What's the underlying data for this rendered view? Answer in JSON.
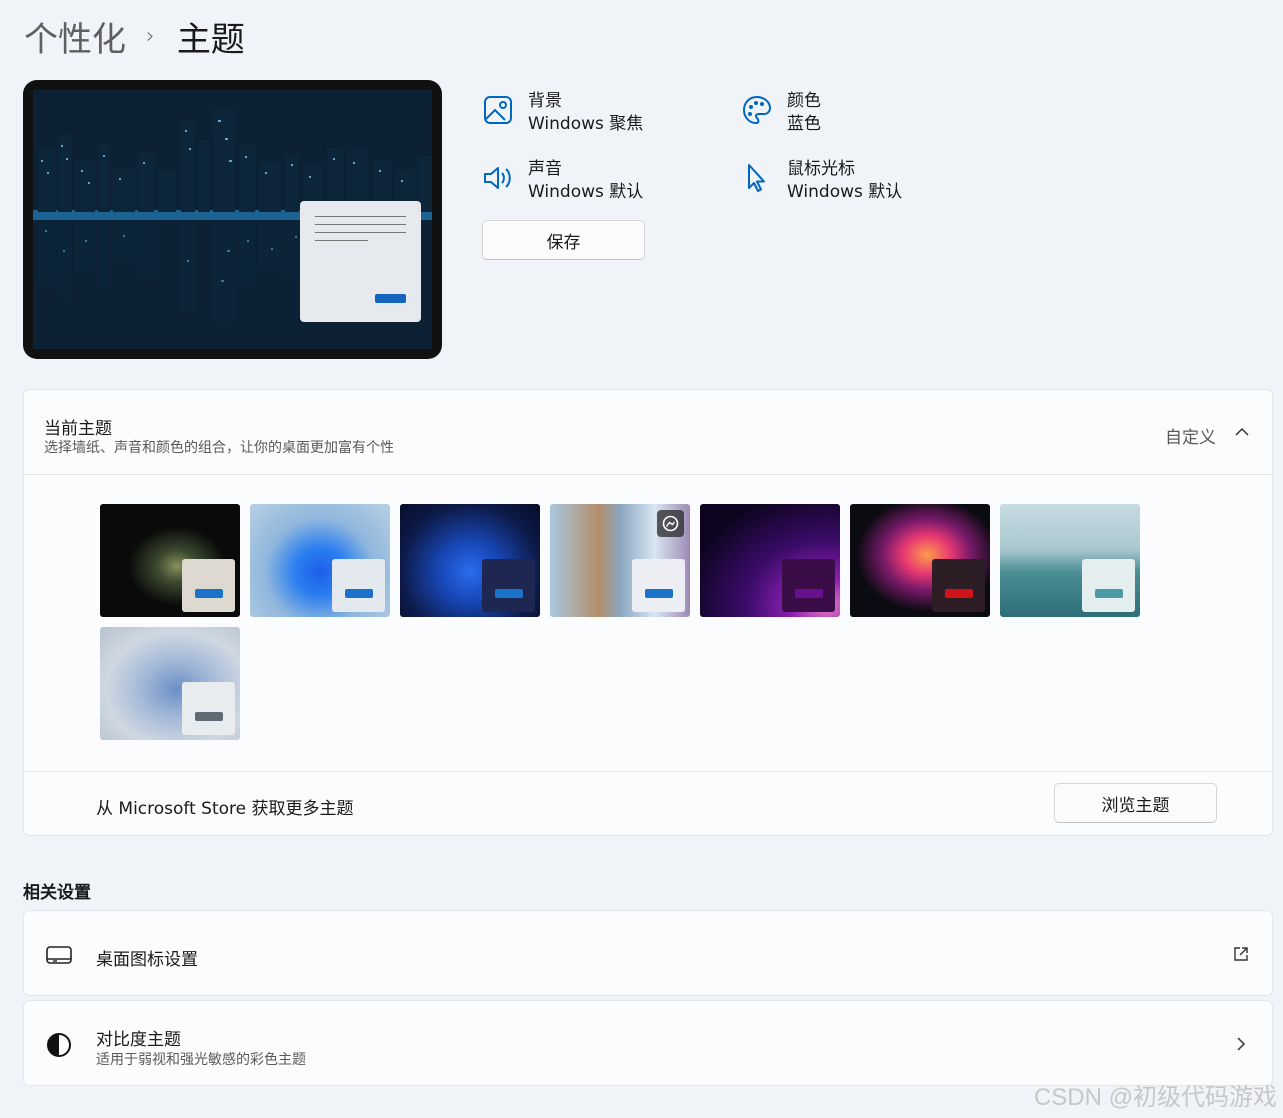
{
  "breadcrumb": {
    "parent": "个性化",
    "separator": "›",
    "current": "主题"
  },
  "theme_attributes": {
    "background": {
      "label": "背景",
      "value": "Windows 聚焦"
    },
    "color": {
      "label": "颜色",
      "value": "蓝色"
    },
    "sound": {
      "label": "声音",
      "value": "Windows 默认"
    },
    "cursor": {
      "label": "鼠标光标",
      "value": "Windows 默认"
    }
  },
  "save_label": "保存",
  "current_theme": {
    "title": "当前主题",
    "subtitle": "选择墙纸、声音和颜色的组合，让你的桌面更加富有个性",
    "value": "自定义",
    "themes": [
      {
        "name": "glow-dark",
        "accent": "#1a73c9"
      },
      {
        "name": "bloom-light",
        "accent": "#1a73c9"
      },
      {
        "name": "bloom-dark",
        "accent": "#1a73c9"
      },
      {
        "name": "spotlight",
        "accent": "#1a73c9"
      },
      {
        "name": "glow-purple",
        "accent": "#6a0f8e"
      },
      {
        "name": "captured-motion",
        "accent": "#d0121b"
      },
      {
        "name": "sunrise-lake",
        "accent": "#4a9aa8"
      },
      {
        "name": "flow",
        "accent": "#5f6a74"
      }
    ],
    "store_text": "从 Microsoft Store 获取更多主题",
    "browse_label": "浏览主题"
  },
  "related": {
    "title": "相关设置",
    "desktop_icons": {
      "label": "桌面图标设置"
    },
    "contrast": {
      "label": "对比度主题",
      "sub": "适用于弱视和强光敏感的彩色主题"
    }
  },
  "colors": {
    "accent": "#0067c0",
    "page_bg": "#f0f4f9"
  },
  "watermark": "CSDN @初级代码游戏"
}
